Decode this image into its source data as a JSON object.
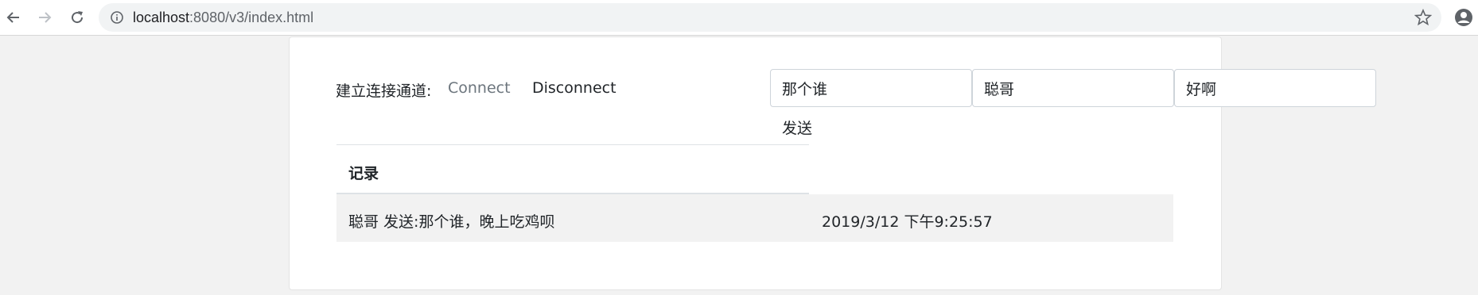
{
  "browser": {
    "url_host": "localhost",
    "url_rest": ":8080/v3/index.html"
  },
  "connection": {
    "label": "建立连接通道:",
    "connect_label": "Connect",
    "disconnect_label": "Disconnect"
  },
  "form": {
    "input1_value": "那个谁",
    "input2_value": "聪哥",
    "input3_value": "好啊",
    "send_label": "发送"
  },
  "records": {
    "header": "记录",
    "rows": [
      {
        "message": "聪哥 发送:那个谁，晚上吃鸡呗",
        "time": "2019/3/12 下午9:25:57"
      }
    ]
  }
}
